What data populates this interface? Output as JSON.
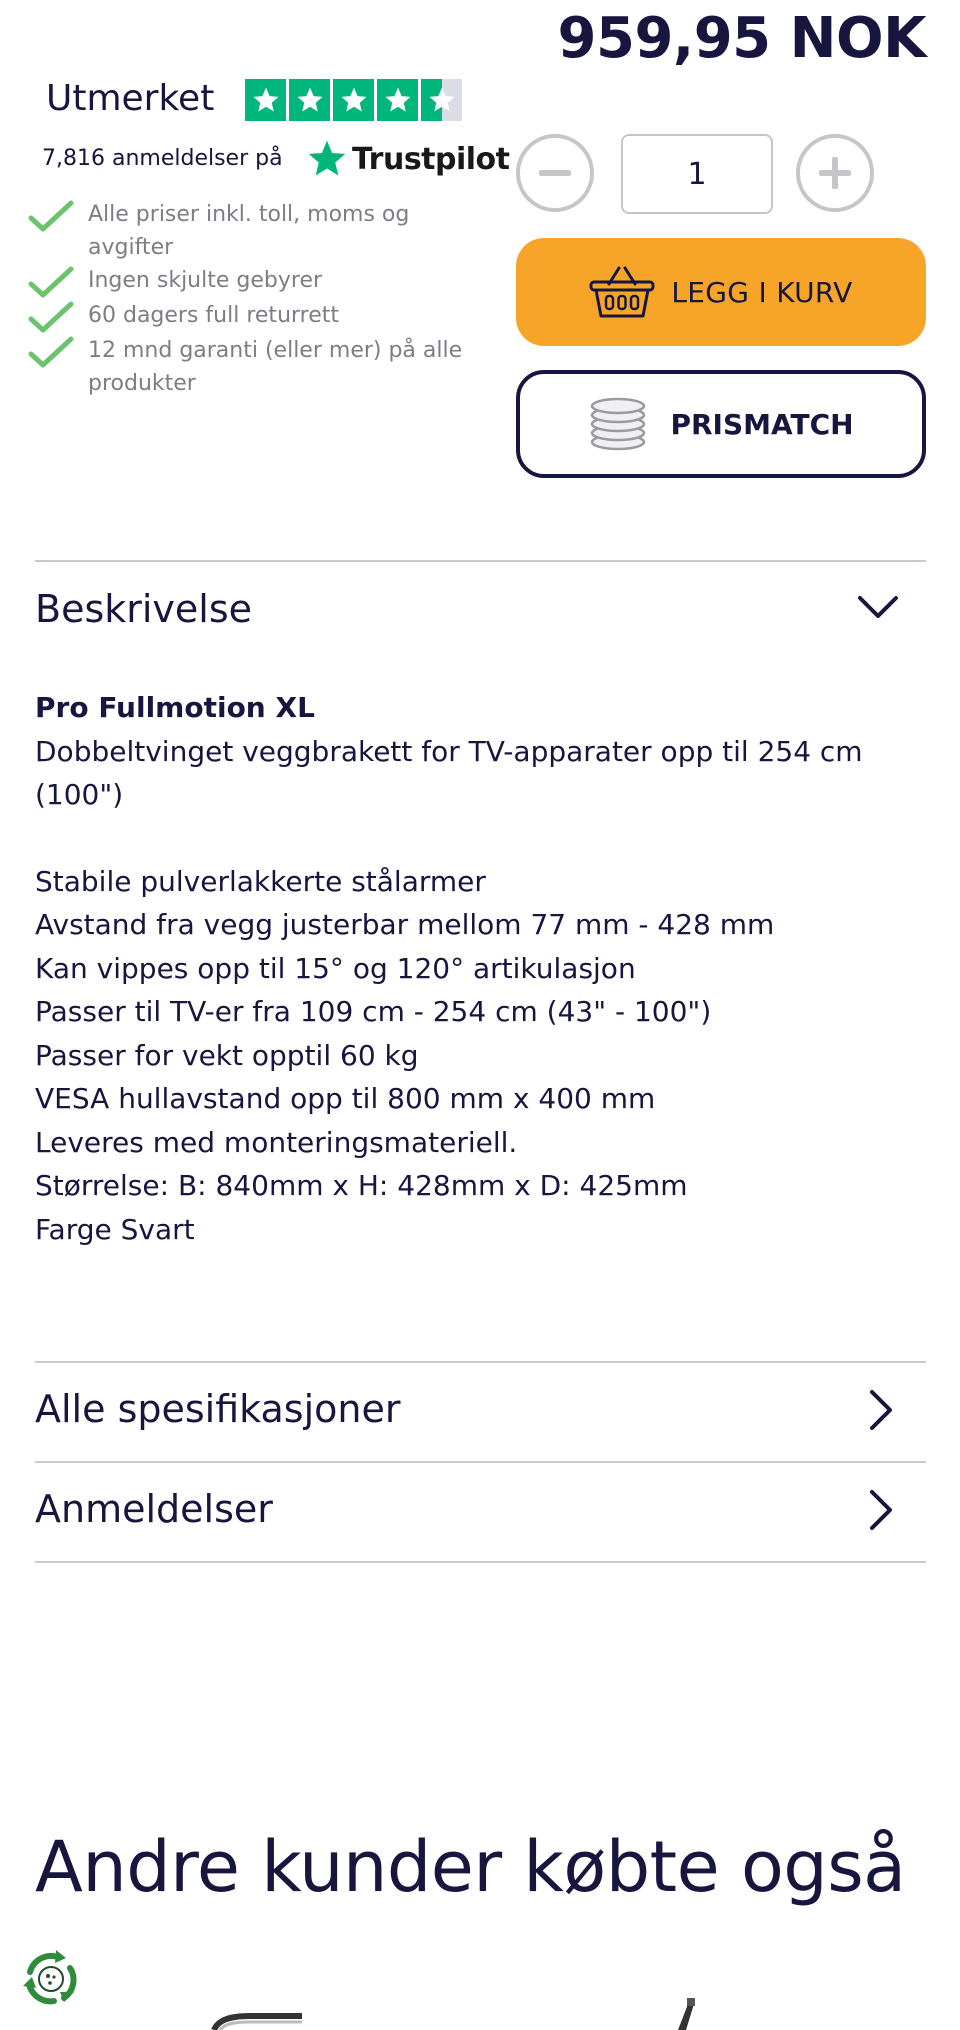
{
  "product": {
    "price": "959,95 NOK",
    "quantity": "1"
  },
  "trustpilot": {
    "rating_label": "Utmerket",
    "stars": 4.5,
    "review_count": "7,816 anmeldelser på",
    "brand": "Trustpilot",
    "brand_color": "#00b67a"
  },
  "usps": [
    "Alle priser inkl. toll, moms og avgifter",
    "Ingen skjulte gebyrer",
    "60 dagers full returrett",
    "12 mnd garanti (eller mer) på alle produkter"
  ],
  "actions": {
    "add_to_cart": "LEGG I KURV",
    "price_match": "PRISMATCH",
    "cart_color": "#f7a529"
  },
  "accordion": {
    "description": {
      "title": "Beskrivelse",
      "product_name": "Pro Fullmotion XL",
      "intro": "Dobbeltvinget veggbrakett for TV-apparater opp til 254 cm (100\")",
      "features": [
        "Stabile pulverlakkerte stålarmer",
        "Avstand fra vegg justerbar mellom 77 mm - 428 mm",
        "Kan vippes opp til 15° og 120° artikulasjon",
        "Passer til TV-er fra 109 cm - 254 cm (43\" - 100\")",
        "Passer for vekt opptil 60 kg",
        "VESA hullavstand opp til 800 mm x 400 mm",
        "Leveres med monteringsmateriell.",
        "Størrelse: B: 840mm x H: 428mm x D: 425mm",
        "Farge Svart"
      ]
    },
    "specs": {
      "title": "Alle spesifikasjoner"
    },
    "reviews": {
      "title": "Anmeldelser"
    }
  },
  "related": {
    "title": "Andre kunder købte også"
  }
}
